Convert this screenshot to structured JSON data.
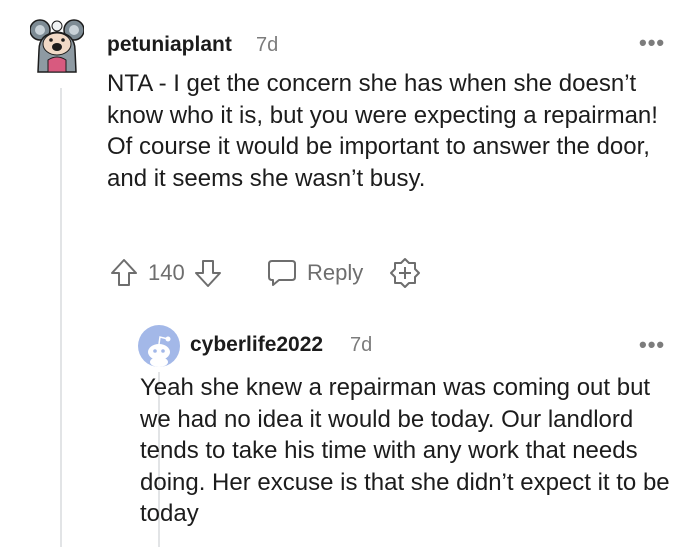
{
  "comments": [
    {
      "username": "petuniaplant",
      "age": "7d",
      "body": "NTA - I get the concern she has when she doesn’t know who it is, but you were expecting a repairman! Of course it would be important to answer the door, and it seems she wasn’t busy.",
      "score": "140",
      "reply_label": "Reply",
      "avatar_icon": "koala-avatar-icon",
      "more_icon": "more-options-icon"
    },
    {
      "username": "cyberlife2022",
      "age": "7d",
      "body": "Yeah she knew a repairman was coming out but we had no idea it would be today. Our landlord tends to take his time with any work that needs doing. Her excuse is that she didn’t expect it to be today",
      "avatar_icon": "default-snoo-avatar-icon",
      "more_icon": "more-options-icon"
    }
  ],
  "more_glyph": "•••",
  "colors": {
    "text": "#1c1c1c",
    "muted": "#7c7c7c",
    "action": "#6e6e6e",
    "thread_line": "#e2e4e6",
    "default_avatar_bg": "#a3b8e8"
  }
}
